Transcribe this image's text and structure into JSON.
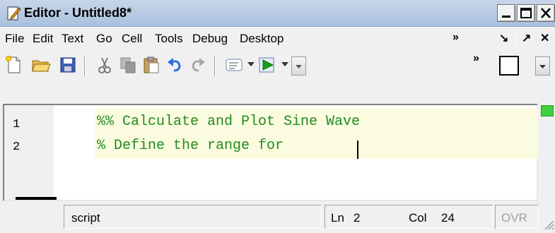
{
  "window": {
    "title": "Editor - Untitled8*",
    "icon": "editor-document-icon"
  },
  "menu": {
    "items": [
      "File",
      "Edit",
      "Text",
      "Go",
      "Cell",
      "Tools",
      "Debug",
      "Desktop"
    ],
    "more": "»",
    "undock": "↘",
    "dock": "↗",
    "close": "✕"
  },
  "toolbar": {
    "icons": [
      "new-file-icon",
      "open-folder-icon",
      "save-icon",
      "cut-icon",
      "copy-icon",
      "paste-icon",
      "undo-icon",
      "redo-icon",
      "comment-icon",
      "run-icon"
    ],
    "more": "»"
  },
  "editor": {
    "lines": [
      {
        "num": "1",
        "text": "%% Calculate and Plot Sine Wave"
      },
      {
        "num": "2",
        "text": "% Define the range for "
      }
    ],
    "comment_color": "#228b22",
    "cell_highlight": "#fbfcdf"
  },
  "status": {
    "type": "script",
    "ln_label": "Ln",
    "ln_value": "2",
    "col_label": "Col",
    "col_value": "24",
    "ovr": "OVR"
  }
}
